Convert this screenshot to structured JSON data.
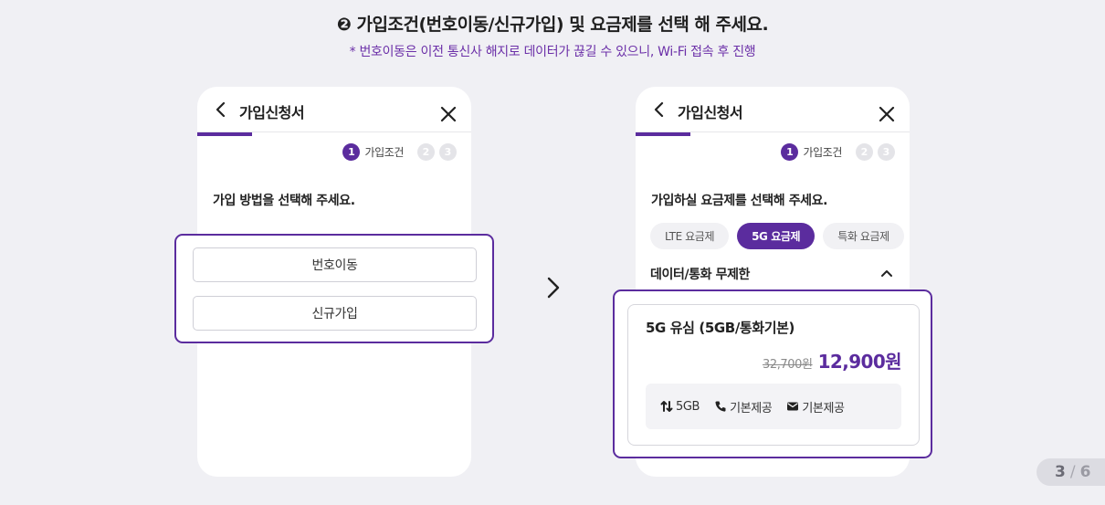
{
  "headline": "❷ 가입조건(번호이동/신규가입) 및 요금제를 선택 해 주세요.",
  "subtext": "* 번호이동은 이전 통신사 해지로 데이터가 끊길 수 있으니, Wi-Fi 접속 후 진행",
  "left_phone": {
    "title": "가입신청서",
    "steps": {
      "step1": "1",
      "step1_label": "가입조건",
      "step2": "2",
      "step3": "3"
    },
    "question": "가입 방법을 선택해 주세요.",
    "options": [
      "번호이동",
      "신규가입"
    ]
  },
  "right_phone": {
    "title": "가입신청서",
    "steps": {
      "step1": "1",
      "step1_label": "가입조건",
      "step2": "2",
      "step3": "3"
    },
    "question": "가입하실 요금제를 선택해 주세요.",
    "tabs": [
      "LTE 요금제",
      "5G 요금제",
      "특화 요금제"
    ],
    "active_tab": "5G 요금제",
    "section": "데이터/통화 무제한",
    "plan": {
      "name": "5G 유심 (5GB/통화기본)",
      "original_price": "32,700원",
      "sale_price": "12,900원",
      "features": {
        "data": "5GB",
        "call": "기본제공",
        "message": "기본제공"
      }
    }
  },
  "pager": {
    "current": "3",
    "separator": "/",
    "total": "6"
  },
  "colors": {
    "accent": "#5b2c9e",
    "subtext": "#6b2fa8",
    "background": "#f0f0f4"
  }
}
